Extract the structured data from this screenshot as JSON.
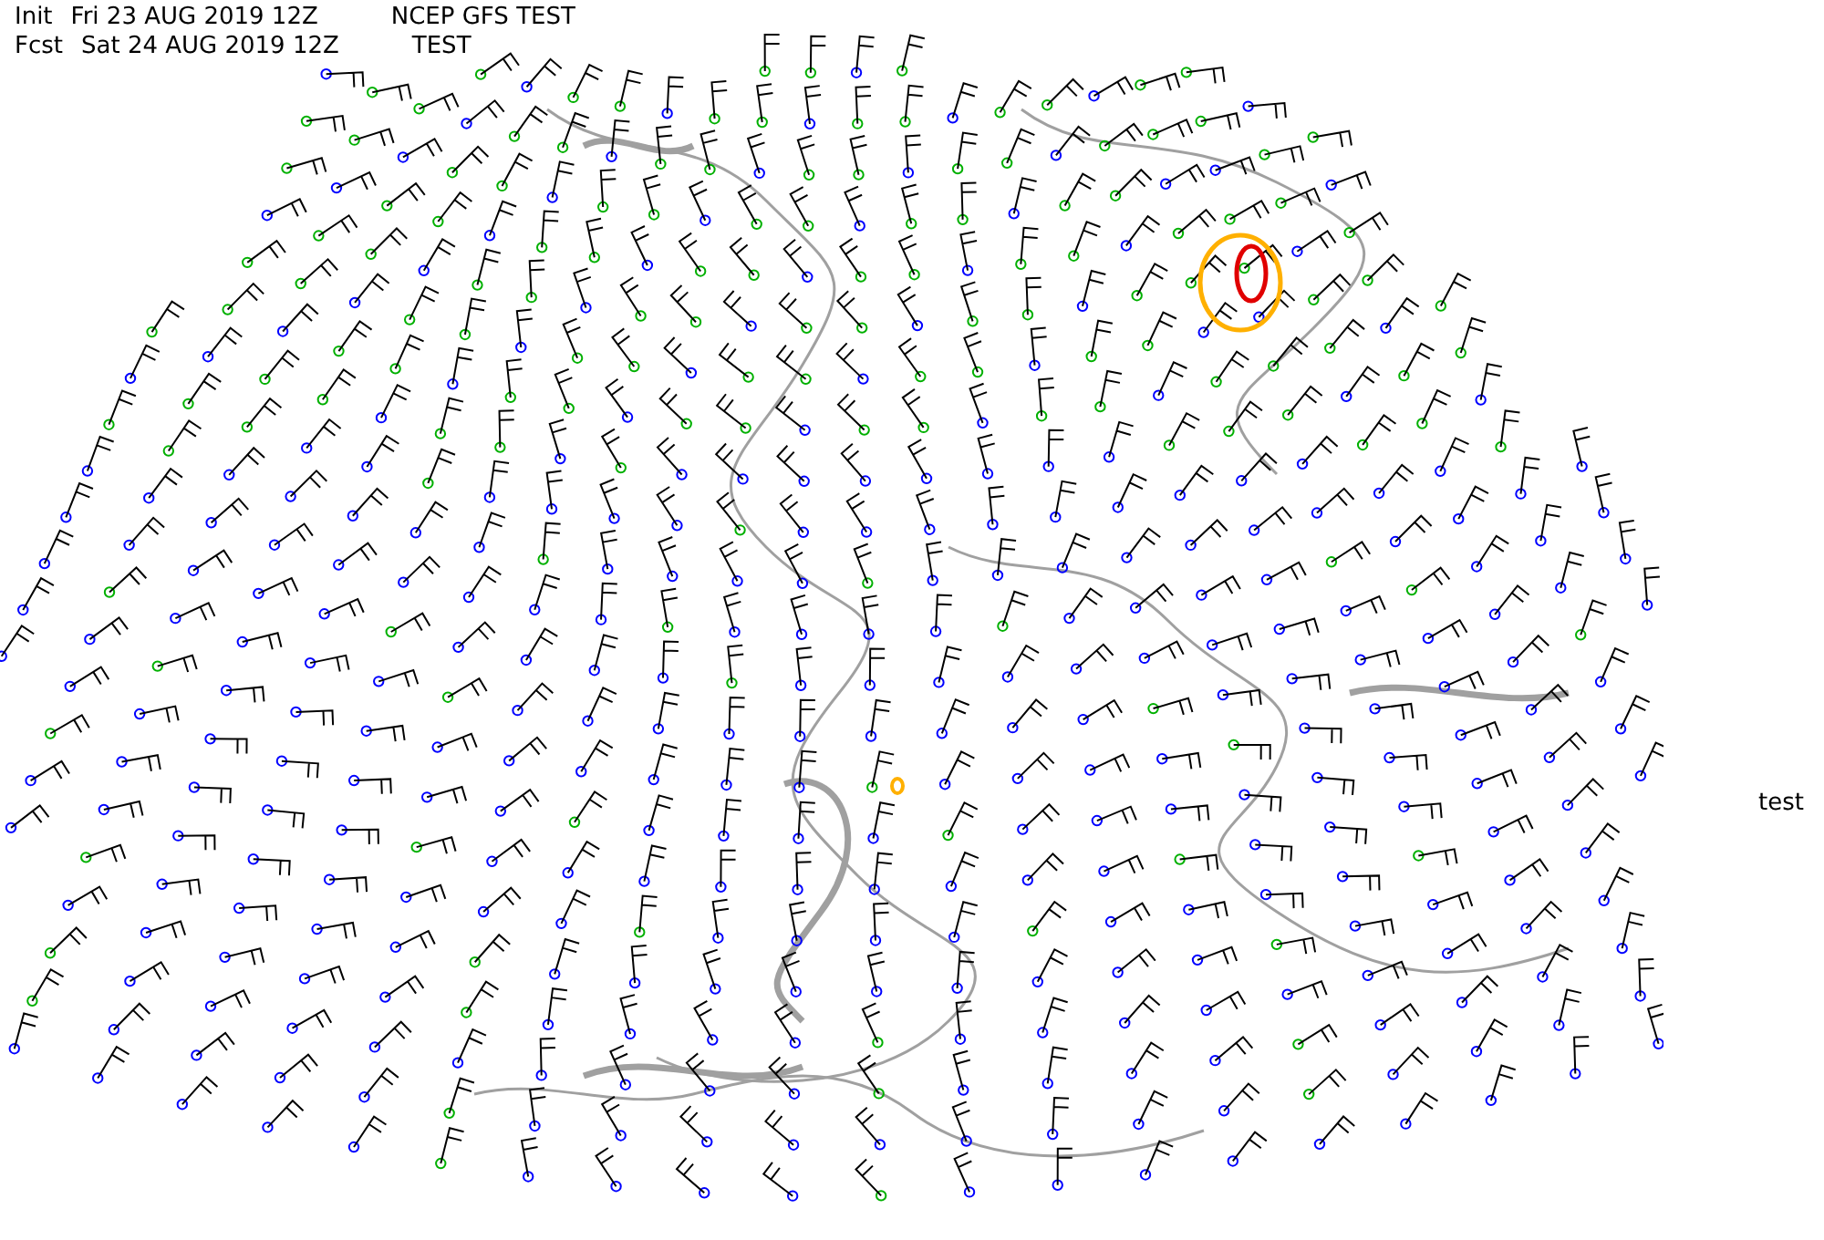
{
  "header": {
    "init_label": "Init",
    "init_time": "Fri 23 AUG 2019 12Z",
    "title": "NCEP GFS TEST",
    "forecast_label": "Fcst",
    "forecast_time": "Sat 24 AUG 2019 12Z",
    "forecast_title": "TEST"
  },
  "side_label": "test"
}
